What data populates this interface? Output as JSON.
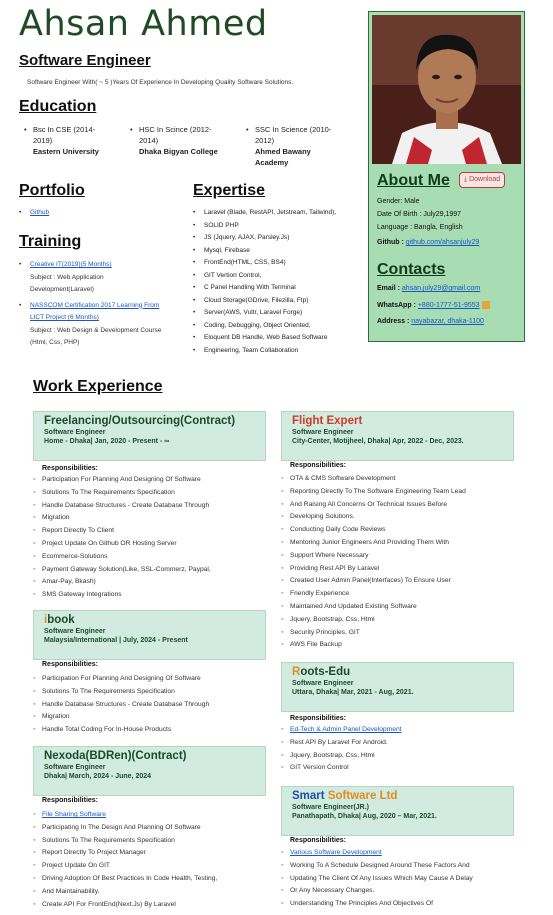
{
  "header": {
    "name": "Ahsan Ahmed",
    "role": "Software Engineer",
    "summary": "Software Engineer With( ~ 5 )Years Of Experience In Developing Quality Software Solutions."
  },
  "education": {
    "title": "Education",
    "items": [
      {
        "degree": "Bsc In CSE (2014-",
        "degree2": "2019)",
        "institution": "Eastern University",
        "institution2": ""
      },
      {
        "degree": "HSC In Scince (2012-",
        "degree2": "2014)",
        "institution": "Dhaka Bigyan College",
        "institution2": ""
      },
      {
        "degree": "SSC In Science (2010-",
        "degree2": "2012)",
        "institution": "Ahmed Bawany",
        "institution2": "Academy"
      }
    ]
  },
  "portfolio": {
    "title": "Portfolio",
    "link": "Github"
  },
  "training": {
    "title": "Training",
    "items": [
      {
        "link": "Creative IT(2019)(5 Months)",
        "subject1": "Subject : Web Application",
        "subject2": "Development(Laravel)"
      },
      {
        "link": "NASSCOM Certification 2017 Learning From",
        "link2": "LICT Project (6 Months)",
        "subject1": "Subject : Web Design & Development Course",
        "subject2": "(Html, Css, PHP)"
      }
    ]
  },
  "expertise": {
    "title": "Expertise",
    "items": [
      "Laravel (Blade, RestAPI, Jetstream, Tailwind),",
      "SOLID PHP",
      "JS (Jquery, AJAX, Parsley.Js)",
      "Mysql, Firebase",
      "FrontEnd(HTML, CSS, BS4)",
      "GIT Vertion Control,",
      "C Panel Handling With Terminal",
      "Cloud Storage(GDrive, Filezilla, Ftp)",
      "Server(AWS, Vultr, Laravel Forge)",
      "Coding, Debugging, Object Oriented,",
      "Eloquent DB Handle, Web Based Software",
      "Engineering, Team Collaboration"
    ]
  },
  "about": {
    "title": "About Me",
    "download": "Download",
    "gender_label": "Gender:",
    "gender": "Male",
    "dob_label": "Date Of Birth :",
    "dob": "July29,1997",
    "language_label": "Language :",
    "language": "Bangla, English",
    "github_label": "Github :",
    "github": "github.com/ahsanjuly29"
  },
  "contacts": {
    "title": "Contacts",
    "email_label": "Email :",
    "email": "ahsan.july29@gmail.com",
    "whatsapp_label": "WhatsApp :",
    "whatsapp": "+880-1777-51-9553",
    "address_label": "Address :",
    "address": "nayabazar, dhaka-1100"
  },
  "work": {
    "title": "Work Experience",
    "responsibilities_label": "Responsibilities:",
    "jobs": [
      {
        "company": "Freelancing/Outsourcing(Contract)",
        "role": "Software Engineer",
        "meta": "Home - Dhaka| Jan, 2020 - Present - ∞",
        "items": [
          "Participation For Planning And Designing Of Software",
          "Solutions To The Requirements Specification",
          "Handle Database Structures - Create Database Through",
          "Migration",
          "Report Directly To Client",
          "Project Update On Github OR Hosting Server",
          "Ecommerce-Solutions",
          "Payment Gateway Solution(Like, SSL-Commerz, Paypal,",
          "Amar-Pay, Bkash)",
          "SMS Gateway Integrations"
        ]
      },
      {
        "company_first": "i",
        "company": "book",
        "role": "Software Engineer",
        "meta": "Malaysia/International | July, 2024 - Present",
        "items": [
          "Participation For Planning And Designing Of Software",
          "Solutions To The Requirements Specification",
          "Handle Database Structures - Create Database Through",
          "Migration",
          "Handle Total Coding For In-House Products"
        ]
      },
      {
        "company": "Nexoda(BDRen)(Contract)",
        "role": "Software Engineer",
        "meta": "Dhaka| March, 2024 - June, 2024",
        "items": [
          "File Sharing Software",
          "Participating In The Design And Planning Of Software",
          "Solutions To The Requirements Specification",
          "Report Directly To Project Manager",
          "Project Update On GIT",
          "Driving Adoption Of Best Practices In Code Health, Testing,",
          "And Maintainability.",
          "Create API For FrontEnd(Next.Js) By Laravel"
        ]
      },
      {
        "company": "Flight Expert",
        "role": "Software Engineer",
        "meta": "City-Center, Motijheel, Dhaka| Apr, 2022 - Dec, 2023.",
        "items": [
          "OTA & CMS Software Development",
          "Reporting Directly To The Software Engineering Team Lead",
          "And Raising All Concerns Or Technical Issues Before",
          "Developing Solutions.",
          "Conducting Daily Code Reviews",
          "Mentoring Junior Engineers And Providing Them With",
          "Support Where Necessary",
          "Providing Rest API By Laravel",
          "Created User Admin Panel(Interfaces) To Ensure User",
          "Friendly Experience",
          "Maintained And Updated Existing Software",
          "Jquery, Bootstrap, Css, Html",
          "Security Principles, GIT",
          "AWS File Backup"
        ]
      },
      {
        "company_first": "R",
        "company": "oots-Edu",
        "role": "Software Engineer",
        "meta": "Uttara, Dhaka| Mar, 2021 - Aug, 2021.",
        "items": [
          "Ed-Tech & Admin Panel Development",
          "Rest API By Laravel For Android.",
          "Jquery, Bootstrap, Css, Html",
          "GIT Version Control"
        ]
      },
      {
        "company_first": "Smart",
        "company": "Software Ltd",
        "role": "Software Engineer(JR.)",
        "meta": "Panathapath, Dhaka| Aug, 2020 – Mar, 2021.",
        "items": [
          "Various Software Development",
          "Working To A Schedule Designed Around These Factors And",
          "Updating The Client Of Any Issues Which May Cause A Delay",
          "Or Any Necessary Changes.",
          "Understanding The Principles And Objectives Of"
        ]
      }
    ]
  },
  "colors": {
    "name_green": "#1f4a23",
    "profile_bg": "#a8dcb2",
    "card_bg": "#d2ebe0",
    "flight_red": "#d03a2a",
    "roots_orange": "#e38b1e",
    "smart_blue": "#1c4fa8"
  }
}
